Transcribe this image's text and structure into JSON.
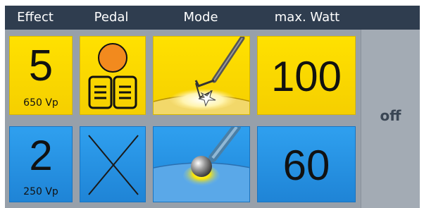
{
  "header": {
    "effect": "Effect",
    "pedal": "Pedal",
    "mode": "Mode",
    "max_watt": "max. Watt"
  },
  "channel_1": {
    "effect_value": "5",
    "effect_sub": "650 Vp",
    "pedal_icon": "pedal-assigned-icon",
    "mode_icon": "cutting-electrode-icon",
    "max_watt": "100",
    "color": "#f5d600"
  },
  "channel_2": {
    "effect_value": "2",
    "effect_sub": "250 Vp",
    "pedal_icon": "no-pedal-icon",
    "mode_icon": "ball-electrode-icon",
    "max_watt": "60",
    "color": "#2a93e6"
  },
  "side": {
    "status": "off"
  },
  "colors": {
    "header_bg": "#2f3d4f",
    "panel_bg": "#97a0aa",
    "pedal_dot": "#f28a1e"
  }
}
